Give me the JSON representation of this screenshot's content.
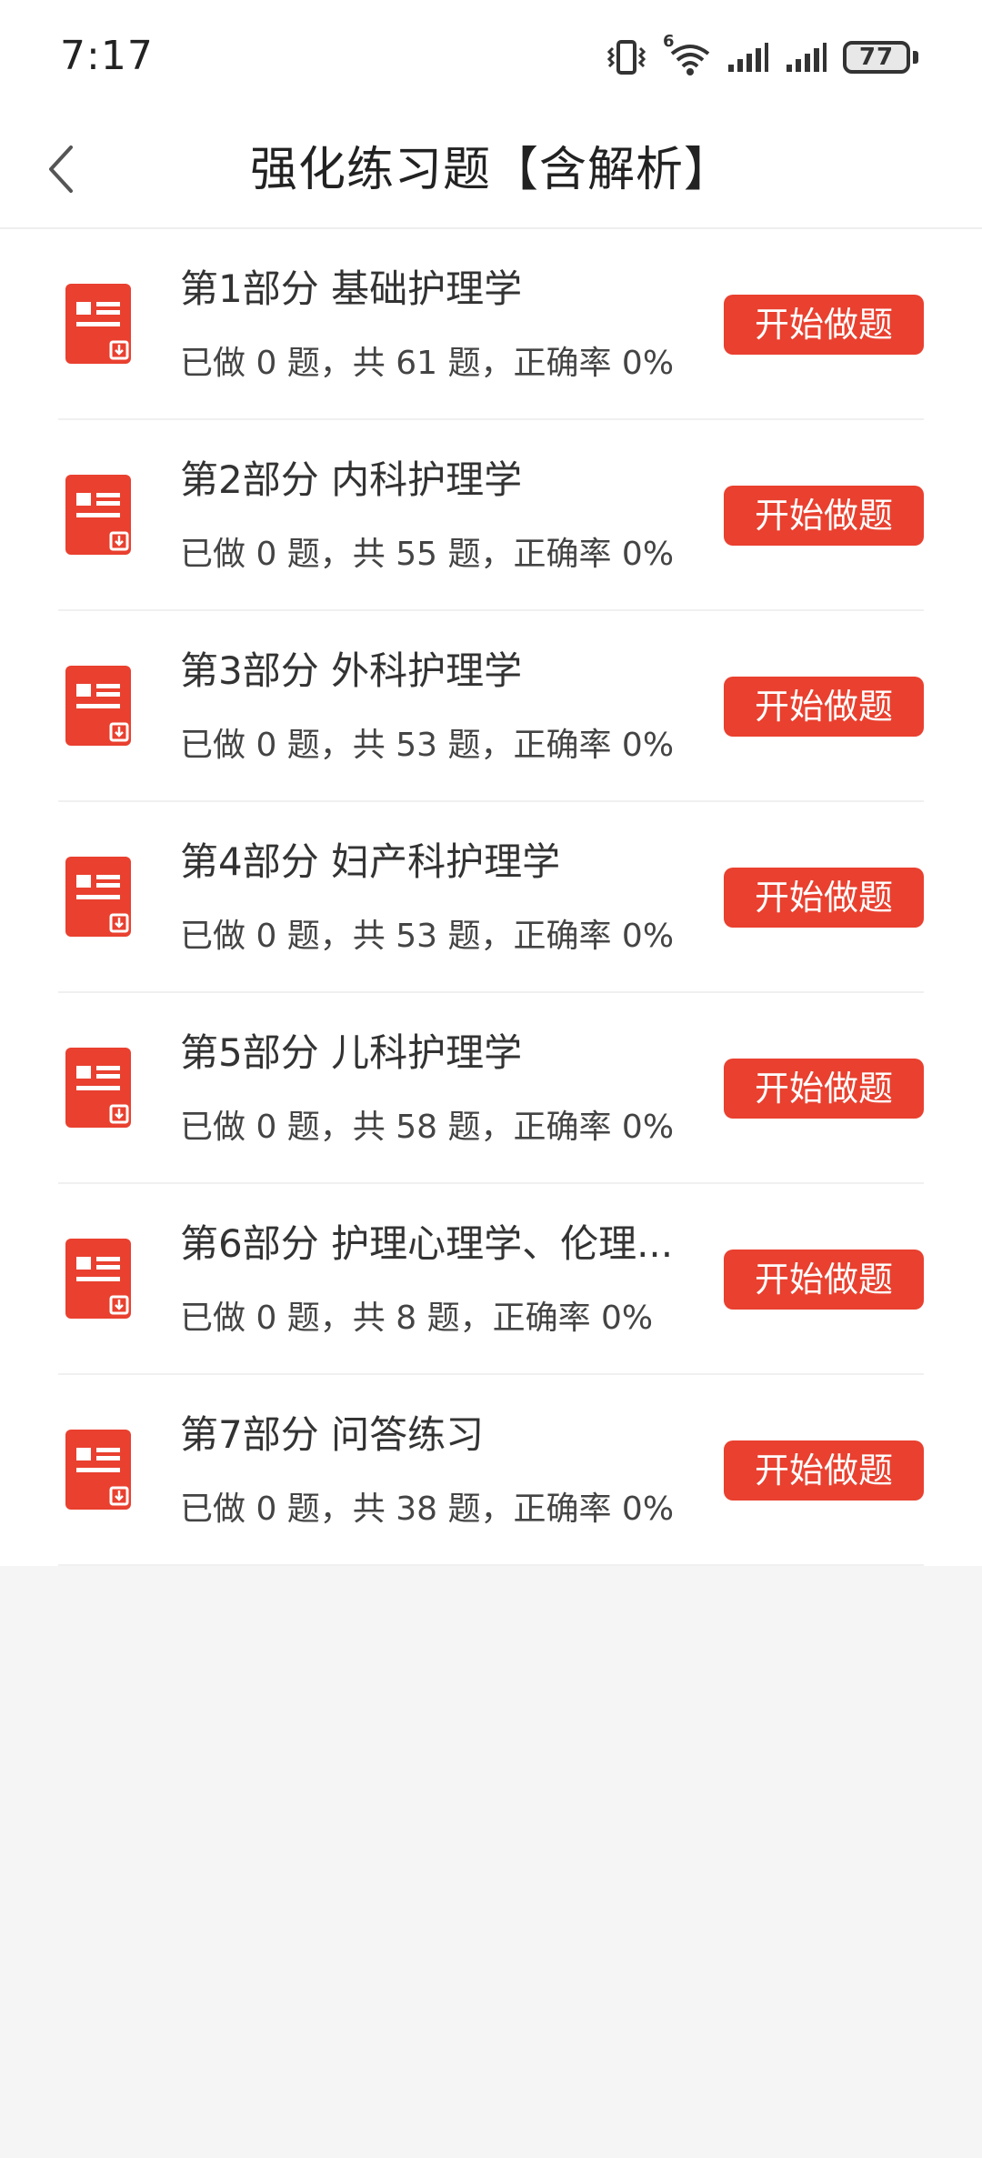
{
  "status_bar": {
    "time": "7:17",
    "network_badge": "6",
    "battery_level": "77"
  },
  "nav": {
    "title": "强化练习题【含解析】",
    "back_icon": "chevron-left-icon"
  },
  "colors": {
    "accent": "#e9402f",
    "background": "#f5f5f5",
    "card": "#ffffff",
    "divider": "#f0f0f0"
  },
  "list": {
    "item_icon": "document-download-icon",
    "items": [
      {
        "title": "第1部分 基础护理学",
        "stats": "已做 0 题，共 61 题，正确率 0%",
        "button": "开始做题"
      },
      {
        "title": "第2部分 内科护理学",
        "stats": "已做 0 题，共 55 题，正确率 0%",
        "button": "开始做题"
      },
      {
        "title": "第3部分 外科护理学",
        "stats": "已做 0 题，共 53 题，正确率 0%",
        "button": "开始做题"
      },
      {
        "title": "第4部分 妇产科护理学",
        "stats": "已做 0 题，共 53 题，正确率 0%",
        "button": "开始做题"
      },
      {
        "title": "第5部分 儿科护理学",
        "stats": "已做 0 题，共 58 题，正确率 0%",
        "button": "开始做题"
      },
      {
        "title": "第6部分 护理心理学、伦理...",
        "stats": "已做 0 题，共 8 题，正确率 0%",
        "button": "开始做题"
      },
      {
        "title": "第7部分 问答练习",
        "stats": "已做 0 题，共 38 题，正确率 0%",
        "button": "开始做题"
      }
    ]
  }
}
